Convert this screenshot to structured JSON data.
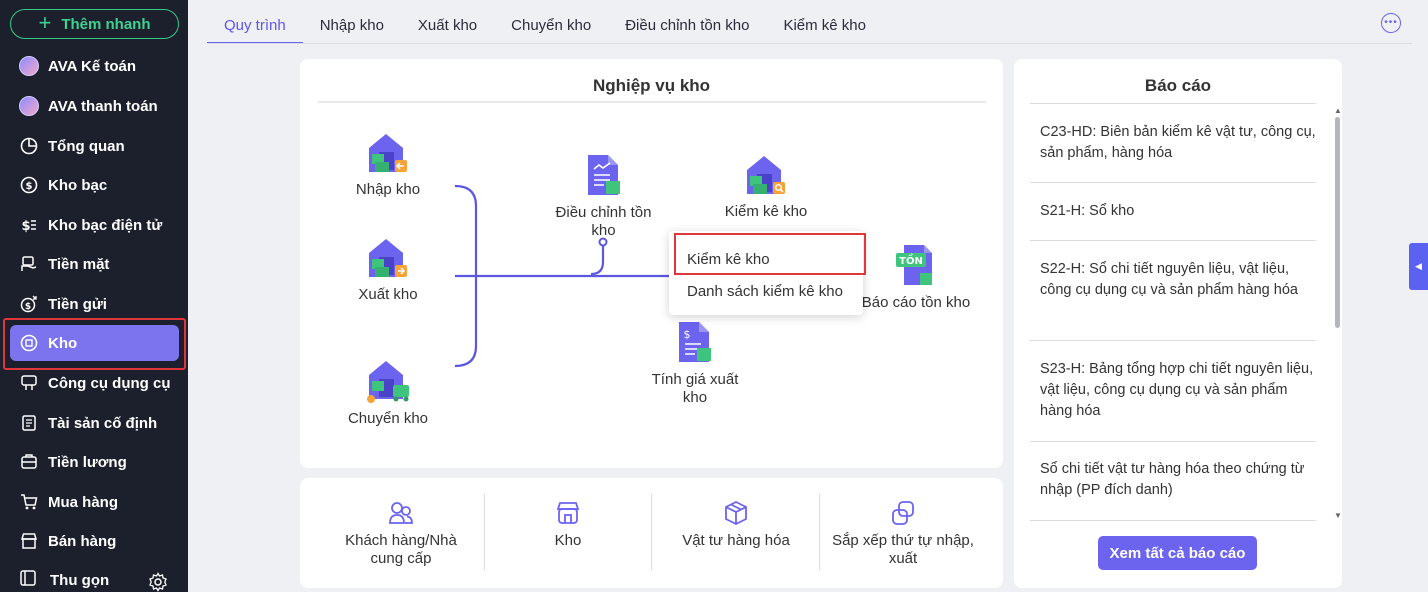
{
  "sidebar": {
    "quick_add": "Thêm nhanh",
    "items": [
      {
        "label": "AVA Kế toán",
        "icon": "avatar-icon"
      },
      {
        "label": "AVA thanh toán",
        "icon": "avatar-icon"
      },
      {
        "label": "Tổng quan",
        "icon": "pie-chart-icon"
      },
      {
        "label": "Kho bạc",
        "icon": "dollar-circle-icon"
      },
      {
        "label": "Kho bạc điện tử",
        "icon": "dollar-transfer-icon"
      },
      {
        "label": "Tiền mặt",
        "icon": "cash-hand-icon"
      },
      {
        "label": "Tiền gửi",
        "icon": "deposit-icon"
      },
      {
        "label": "Kho",
        "icon": "warehouse-icon"
      },
      {
        "label": "Công cụ dụng cụ",
        "icon": "tools-icon"
      },
      {
        "label": "Tài sản cố định",
        "icon": "asset-icon"
      },
      {
        "label": "Tiền lương",
        "icon": "salary-icon"
      },
      {
        "label": "Mua hàng",
        "icon": "cart-icon"
      },
      {
        "label": "Bán hàng",
        "icon": "store-icon"
      }
    ],
    "collapse": "Thu gọn"
  },
  "tabs": [
    "Quy trình",
    "Nhập kho",
    "Xuất kho",
    "Chuyển kho",
    "Điều chỉnh tồn kho",
    "Kiểm kê kho"
  ],
  "workflow": {
    "title": "Nghiệp vụ kho",
    "nodes": {
      "nhap": "Nhập kho",
      "xuat": "Xuất kho",
      "chuyen": "Chuyển kho",
      "dieu_chinh": "Điều chỉnh tồn kho",
      "kiem_ke": "Kiểm kê kho",
      "bao_cao": "Báo cáo tồn kho",
      "bao_cao_badge": "TỒN",
      "tinh_gia": "Tính giá xuất kho"
    },
    "dropdown": [
      "Kiểm kê kho",
      "Danh sách kiểm kê kho"
    ]
  },
  "shortcuts": [
    "Khách hàng/Nhà cung cấp",
    "Kho",
    "Vật tư hàng hóa",
    "Sắp xếp thứ tự nhập, xuất"
  ],
  "reports": {
    "title": "Báo cáo",
    "items": [
      "C23-HD: Biên bản kiểm kê vật tư, công cụ, sản phẩm, hàng hóa",
      "S21-H: Sổ kho",
      "S22-H: Sổ chi tiết nguyên liệu, vật liệu, công cụ dụng cụ và sản phẩm hàng hóa",
      "S23-H: Bảng tổng hợp chi tiết nguyên liệu, vật liệu, công cụ dụng cụ và sản phẩm hàng hóa",
      "Sổ chi tiết vật tư hàng hóa theo chứng từ nhập (PP đích danh)"
    ],
    "view_all": "Xem tất cả báo cáo"
  },
  "colors": {
    "accent": "#6c63ef",
    "sidebar_bg": "#1c1f2c",
    "green": "#38c987",
    "highlight": "#e0373a"
  }
}
